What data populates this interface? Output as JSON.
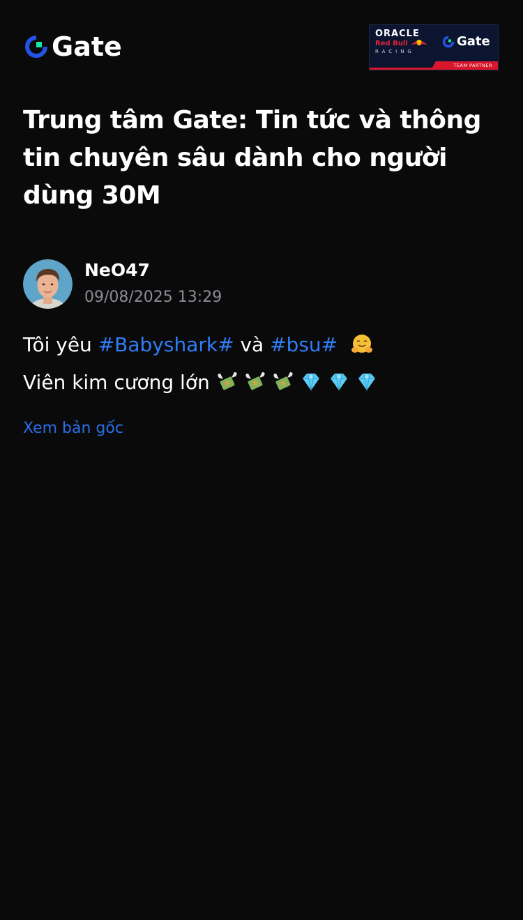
{
  "header": {
    "logo_text": "Gate",
    "partner_badge": {
      "oracle": "ORACLE",
      "redbull": "Red Bull",
      "racing": "RACING",
      "brand": "Gate",
      "tagline": "TEAM PARTNER"
    }
  },
  "article": {
    "title": "Trung tâm Gate: Tin tức và thông tin chuyên sâu dành cho người dùng 30M"
  },
  "author": {
    "name": "NeO47",
    "timestamp": "09/08/2025 13:29"
  },
  "post": {
    "line1_prefix": "Tôi yêu ",
    "hashtag1": "#Babyshark#",
    "line1_middle": " và ",
    "hashtag2": "#bsu#",
    "line2_text": "Viên kim cương lớn ",
    "emoji_line1": "hugging-face",
    "emoji_line2": [
      "money-with-wings",
      "money-with-wings",
      "money-with-wings",
      "gem",
      "gem",
      "gem"
    ]
  },
  "actions": {
    "view_original": "Xem bản gốc"
  },
  "colors": {
    "background": "#0a0a0b",
    "hashtag": "#2f7df6",
    "link": "#2a6de8",
    "muted": "#8a8d95",
    "brand_blue": "#2354e6",
    "brand_green": "#17e6a1"
  }
}
